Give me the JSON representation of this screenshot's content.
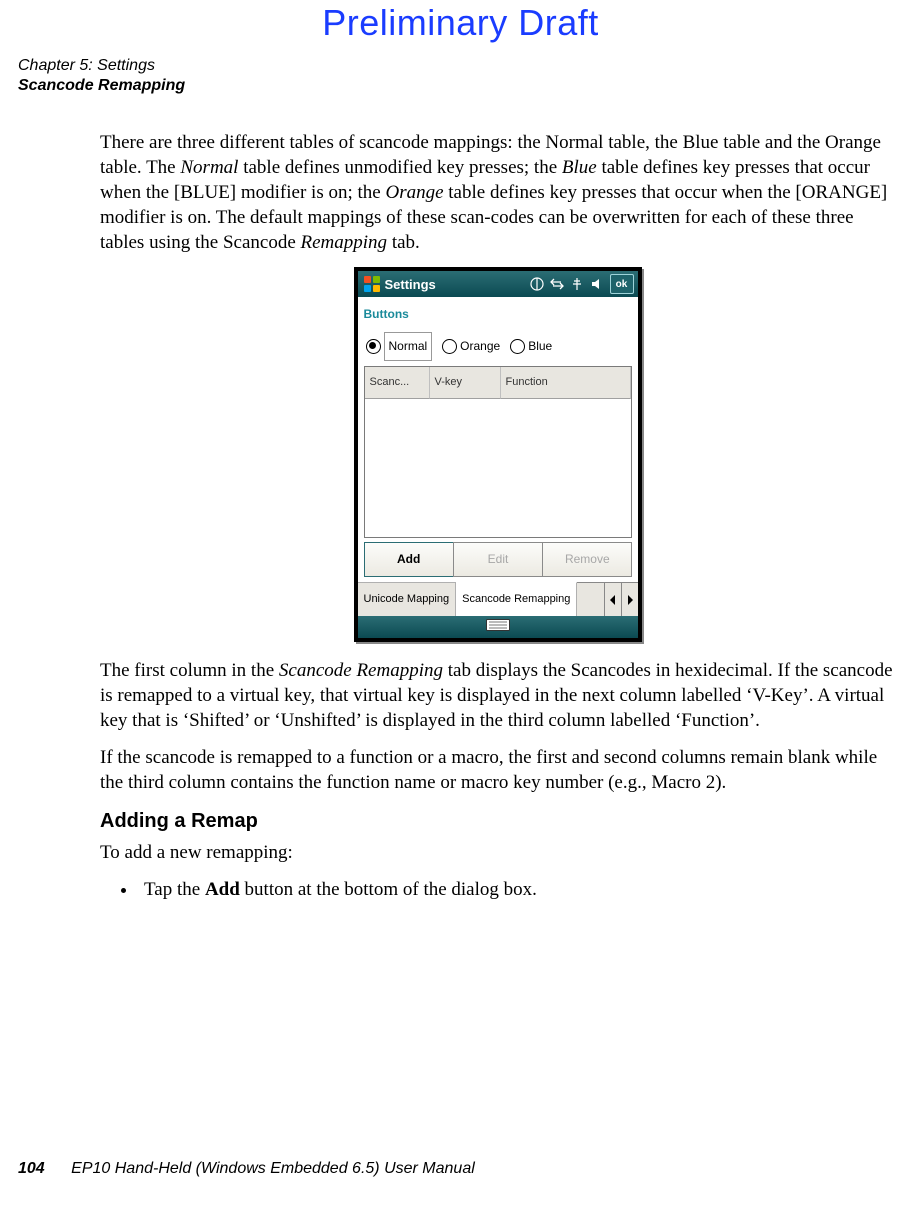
{
  "watermark": "Preliminary Draft",
  "header": {
    "chapter": "Chapter 5: Settings",
    "section": "Scancode Remapping"
  },
  "body": {
    "para1_pre": "There are three different tables of scancode mappings: the Normal table, the Blue table and the Orange table. The ",
    "para1_em1": "Normal",
    "para1_mid1": " table defines unmodified key presses; the ",
    "para1_em2": "Blue",
    "para1_mid2": " table defines key presses that occur when the [BLUE] modifier is on; the ",
    "para1_em3": "Orange",
    "para1_mid3": " table defines key presses that occur when the [ORANGE] modifier is on. The default mappings of these scan-codes can be overwritten for each of these three tables using the Scancode ",
    "para1_em4": "Remapping",
    "para1_end": " tab.",
    "para2_pre": "The first column in the ",
    "para2_em1": "Scancode Remapping",
    "para2_post": " tab displays the Scancodes in hexidecimal. If the scancode is remapped to a virtual key, that virtual key is displayed in the next column labelled ‘V-Key’. A virtual key that is ‘Shifted’ or ‘Unshifted’ is displayed in the third column labelled ‘Function’.",
    "para3": "If the scancode is remapped to a function or a macro, the first and second columns remain blank while the third column contains the function name or macro key number (e.g., Macro 2).",
    "subhead": "Adding a Remap",
    "para4": "To add a new remapping:",
    "bullet_pre": "Tap the ",
    "bullet_b": "Add",
    "bullet_post": " button at the bottom of the dialog box."
  },
  "screenshot": {
    "title": "Settings",
    "ok": "ok",
    "category": "Buttons",
    "radios": {
      "normal": "Normal",
      "orange": "Orange",
      "blue": "Blue"
    },
    "columns": {
      "c1": "Scanc...",
      "c2": "V-key",
      "c3": "Function"
    },
    "buttons": {
      "add": "Add",
      "edit": "Edit",
      "remove": "Remove"
    },
    "tabs": {
      "t1": "Unicode Mapping",
      "t2": "Scancode Remapping"
    }
  },
  "footer": {
    "page": "104",
    "title": "EP10 Hand-Held (Windows Embedded 6.5) User Manual"
  }
}
